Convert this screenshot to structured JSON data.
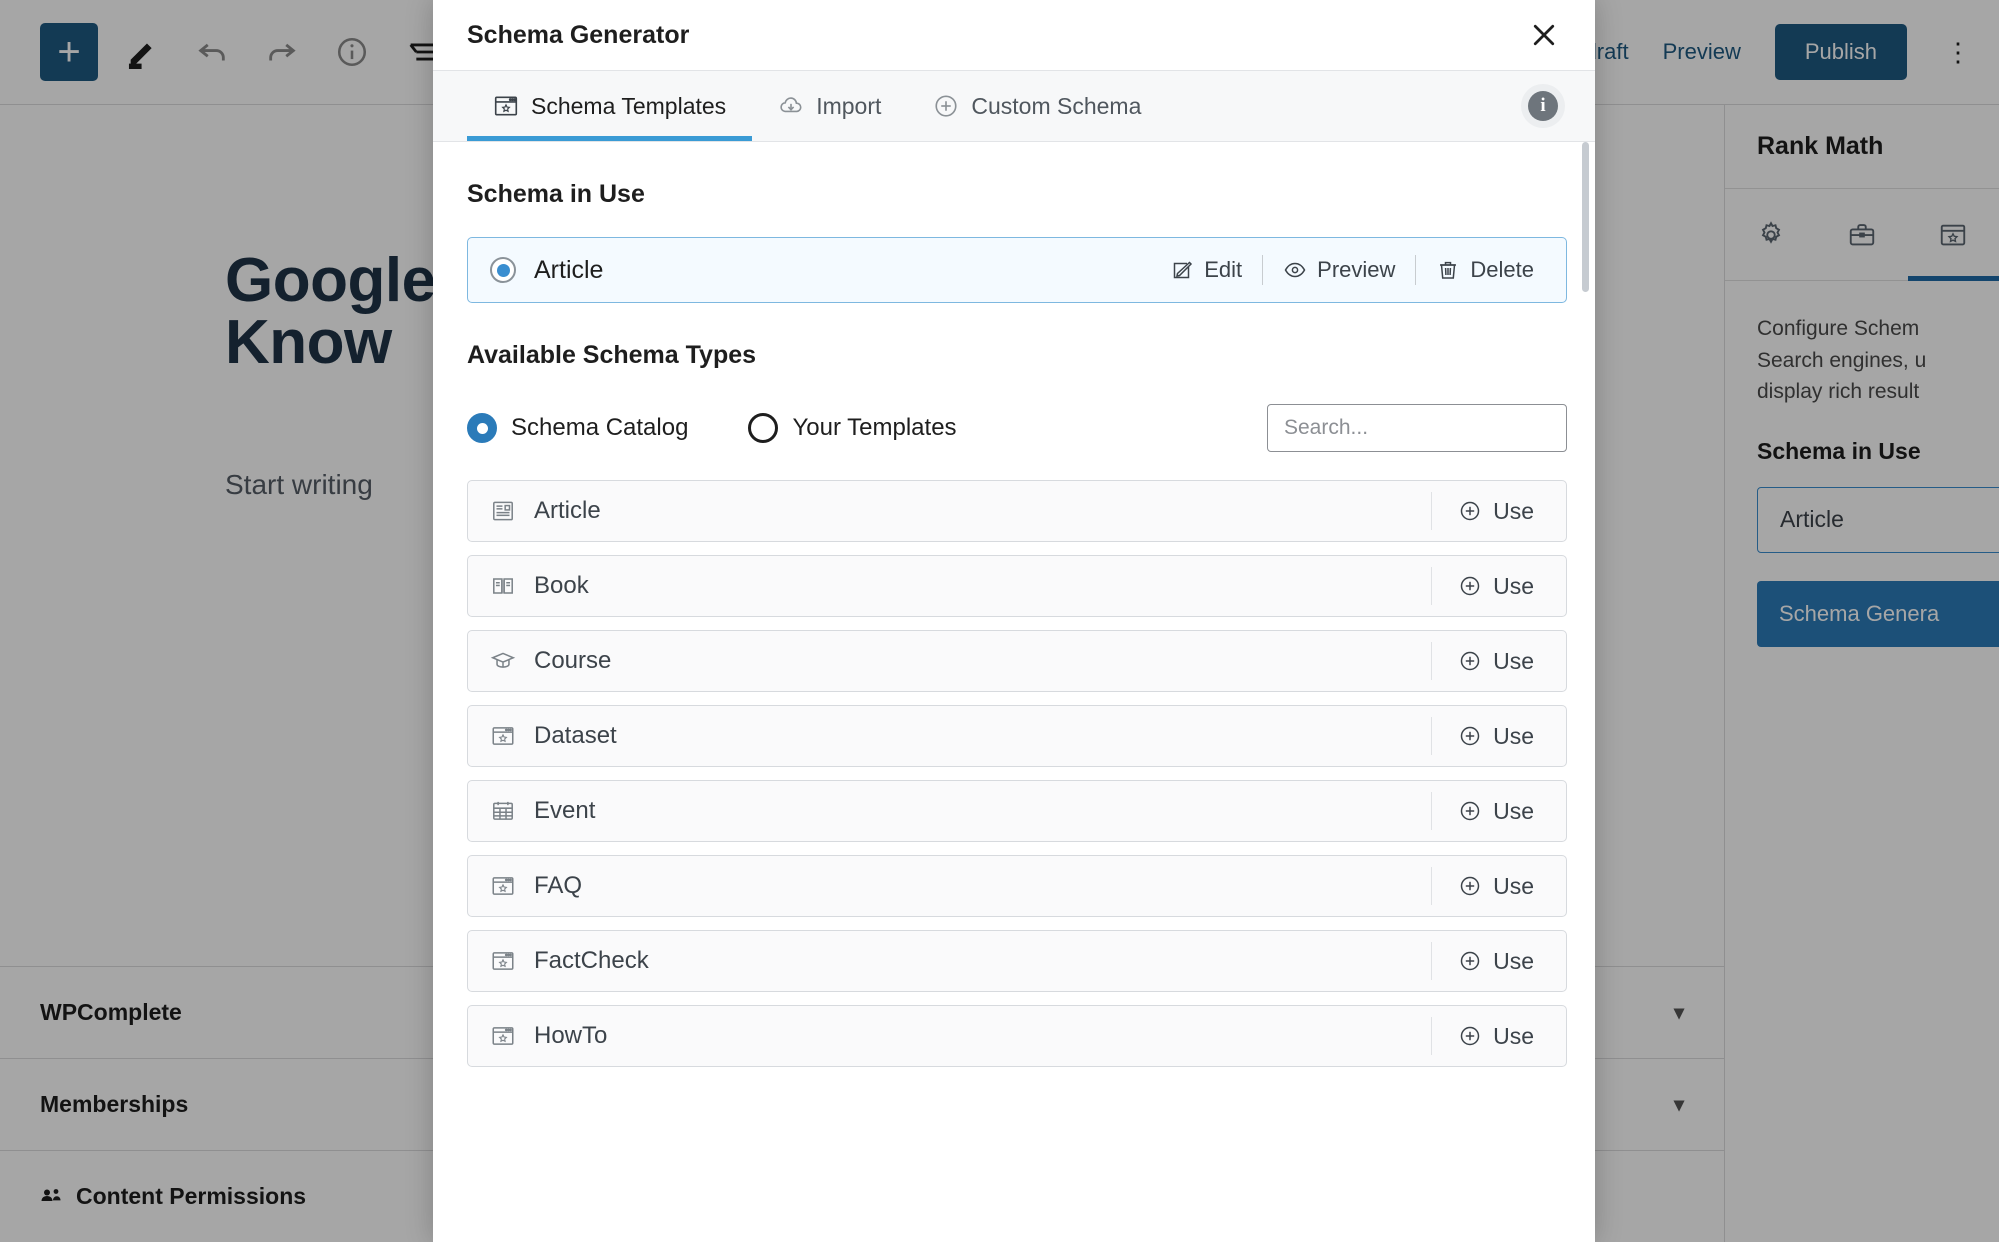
{
  "editor": {
    "toolbar": {
      "add_label": "+",
      "icons": [
        "add-block-icon",
        "edit-pencil-icon",
        "undo-icon",
        "redo-icon",
        "details-info-icon",
        "list-view-icon"
      ],
      "save_draft_label": "e draft",
      "preview_label": "Preview",
      "publish_label": "Publish",
      "more_label": "⋮"
    },
    "post": {
      "title": "Google\nKnow",
      "body_placeholder": "Start writing"
    },
    "bottom_panels": [
      {
        "label": "WPComplete",
        "chevron": "▾"
      },
      {
        "label": "Memberships",
        "chevron": "▾"
      },
      {
        "label": "Content Permissions",
        "chevron": ""
      }
    ]
  },
  "sidebar": {
    "title": "Rank Math",
    "tabs": [
      {
        "name": "general-tab",
        "icon": "gear-icon",
        "active": false
      },
      {
        "name": "advanced-tab",
        "icon": "briefcase-icon",
        "active": false
      },
      {
        "name": "schema-tab",
        "icon": "schema-icon",
        "active": true
      }
    ],
    "description": "Configure Schem\nSearch engines, u\ndisplay rich result",
    "schema_in_use_title": "Schema in Use",
    "schema_in_use_value": "Article",
    "generator_button": "Schema Genera"
  },
  "modal": {
    "title": "Schema Generator",
    "close_icon": "close-icon",
    "tabs": [
      {
        "label": "Schema Templates",
        "icon": "schema-template-icon",
        "active": true
      },
      {
        "label": "Import",
        "icon": "cloud-download-icon",
        "active": false
      },
      {
        "label": "Custom Schema",
        "icon": "plus-circle-icon",
        "active": false
      }
    ],
    "info_icon": "info-icon",
    "in_use": {
      "section_title": "Schema in Use",
      "name": "Article",
      "actions": [
        {
          "label": "Edit",
          "icon": "pencil-square-icon"
        },
        {
          "label": "Preview",
          "icon": "eye-icon"
        },
        {
          "label": "Delete",
          "icon": "trash-icon"
        }
      ]
    },
    "available": {
      "section_title": "Available Schema Types",
      "source_options": [
        {
          "label": "Schema Catalog",
          "selected": true
        },
        {
          "label": "Your Templates",
          "selected": false
        }
      ],
      "search_placeholder": "Search...",
      "use_label": "Use",
      "items": [
        {
          "label": "Article",
          "icon": "article-icon"
        },
        {
          "label": "Book",
          "icon": "book-icon"
        },
        {
          "label": "Course",
          "icon": "graduation-cap-icon"
        },
        {
          "label": "Dataset",
          "icon": "schema-window-icon"
        },
        {
          "label": "Event",
          "icon": "calendar-icon"
        },
        {
          "label": "FAQ",
          "icon": "schema-window-icon"
        },
        {
          "label": "FactCheck",
          "icon": "schema-window-icon"
        },
        {
          "label": "HowTo",
          "icon": "schema-window-icon"
        }
      ]
    }
  },
  "colors": {
    "accent_blue": "#1e5a82",
    "tab_underline": "#3a9bd5",
    "radio_blue": "#2b7bb9",
    "card_border": "#7eb8e0",
    "card_bg": "#f4faff"
  }
}
